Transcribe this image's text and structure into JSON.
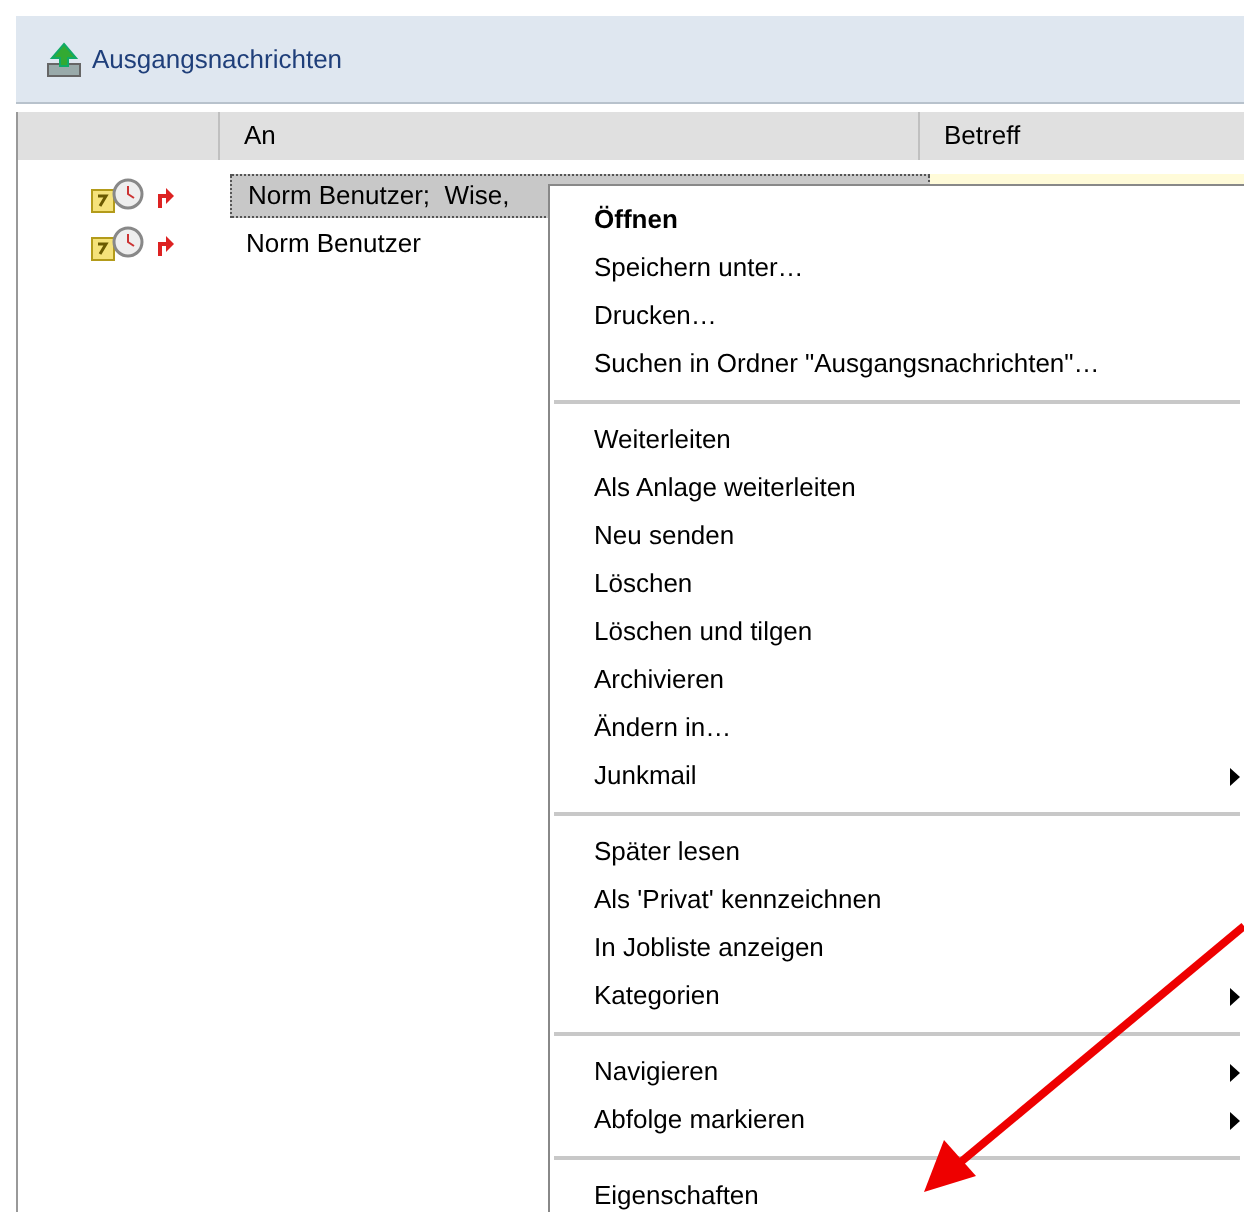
{
  "folder": {
    "title": "Ausgangsnachrichten"
  },
  "table": {
    "columns": [
      {
        "label": "An"
      },
      {
        "label": "Betreff"
      }
    ],
    "rows": [
      {
        "to": "Norm Benutzer;  Wise,",
        "selected": true
      },
      {
        "to": "Norm Benutzer",
        "selected": false
      }
    ]
  },
  "context_menu": {
    "groups": [
      [
        {
          "label": "Öffnen",
          "default": true,
          "submenu": false
        },
        {
          "label": "Speichern unter…",
          "default": false,
          "submenu": false
        },
        {
          "label": "Drucken…",
          "default": false,
          "submenu": false
        },
        {
          "label": "Suchen in Ordner \"Ausgangsnachrichten\"…",
          "default": false,
          "submenu": false
        }
      ],
      [
        {
          "label": "Weiterleiten",
          "default": false,
          "submenu": false
        },
        {
          "label": "Als Anlage weiterleiten",
          "default": false,
          "submenu": false
        },
        {
          "label": "Neu senden",
          "default": false,
          "submenu": false
        },
        {
          "label": "Löschen",
          "default": false,
          "submenu": false
        },
        {
          "label": "Löschen und tilgen",
          "default": false,
          "submenu": false
        },
        {
          "label": "Archivieren",
          "default": false,
          "submenu": false
        },
        {
          "label": "Ändern in…",
          "default": false,
          "submenu": false
        },
        {
          "label": "Junkmail",
          "default": false,
          "submenu": true
        }
      ],
      [
        {
          "label": "Später lesen",
          "default": false,
          "submenu": false
        },
        {
          "label": "Als 'Privat' kennzeichnen",
          "default": false,
          "submenu": false
        },
        {
          "label": "In Jobliste anzeigen",
          "default": false,
          "submenu": false
        },
        {
          "label": "Kategorien",
          "default": false,
          "submenu": true
        }
      ],
      [
        {
          "label": "Navigieren",
          "default": false,
          "submenu": true
        },
        {
          "label": "Abfolge markieren",
          "default": false,
          "submenu": true
        }
      ],
      [
        {
          "label": "Eigenschaften",
          "default": false,
          "submenu": false
        }
      ]
    ]
  }
}
